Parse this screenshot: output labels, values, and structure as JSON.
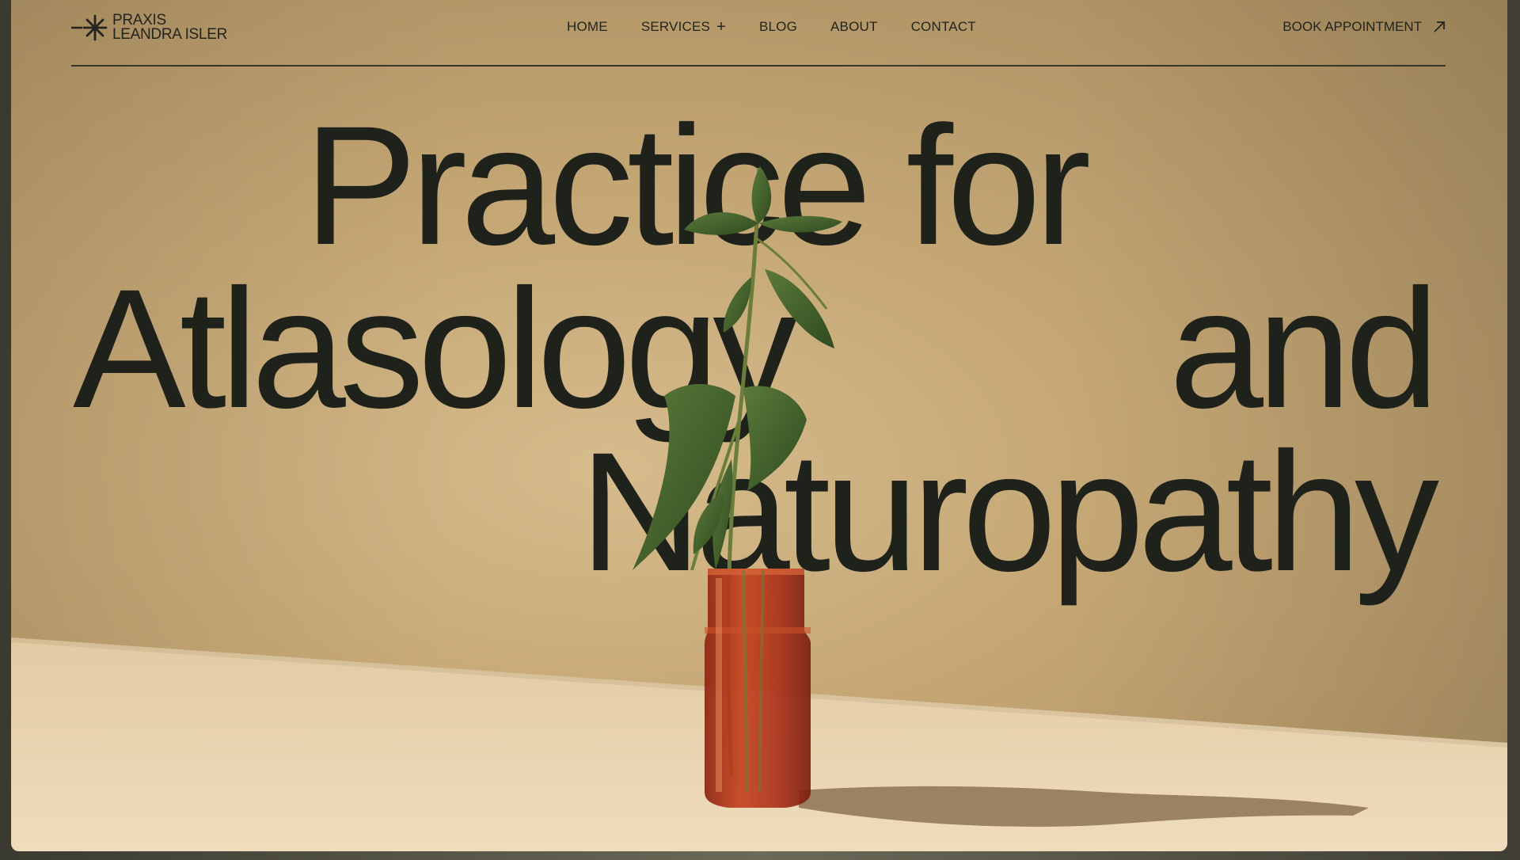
{
  "brand": {
    "line1": "PRAXIS",
    "line2": "LEANDRA ISLER",
    "icon": "asterisk-dash-icon"
  },
  "nav": {
    "items": [
      {
        "label": "HOME"
      },
      {
        "label": "SERVICES",
        "icon": "plus-icon"
      },
      {
        "label": "BLOG"
      },
      {
        "label": "ABOUT"
      },
      {
        "label": "CONTACT"
      }
    ],
    "cta": {
      "label": "BOOK APPOINTMENT",
      "icon": "arrow-up-right-icon"
    }
  },
  "hero": {
    "line1": "Practice for",
    "line2a": "Atlasology",
    "line2b": "and",
    "line3": "Naturopathy"
  },
  "colors": {
    "text": "#1f221b",
    "background": "#c5a775",
    "table": "#ead8b8",
    "vase": "#b3371d",
    "leaf": "#3e5a2a"
  }
}
